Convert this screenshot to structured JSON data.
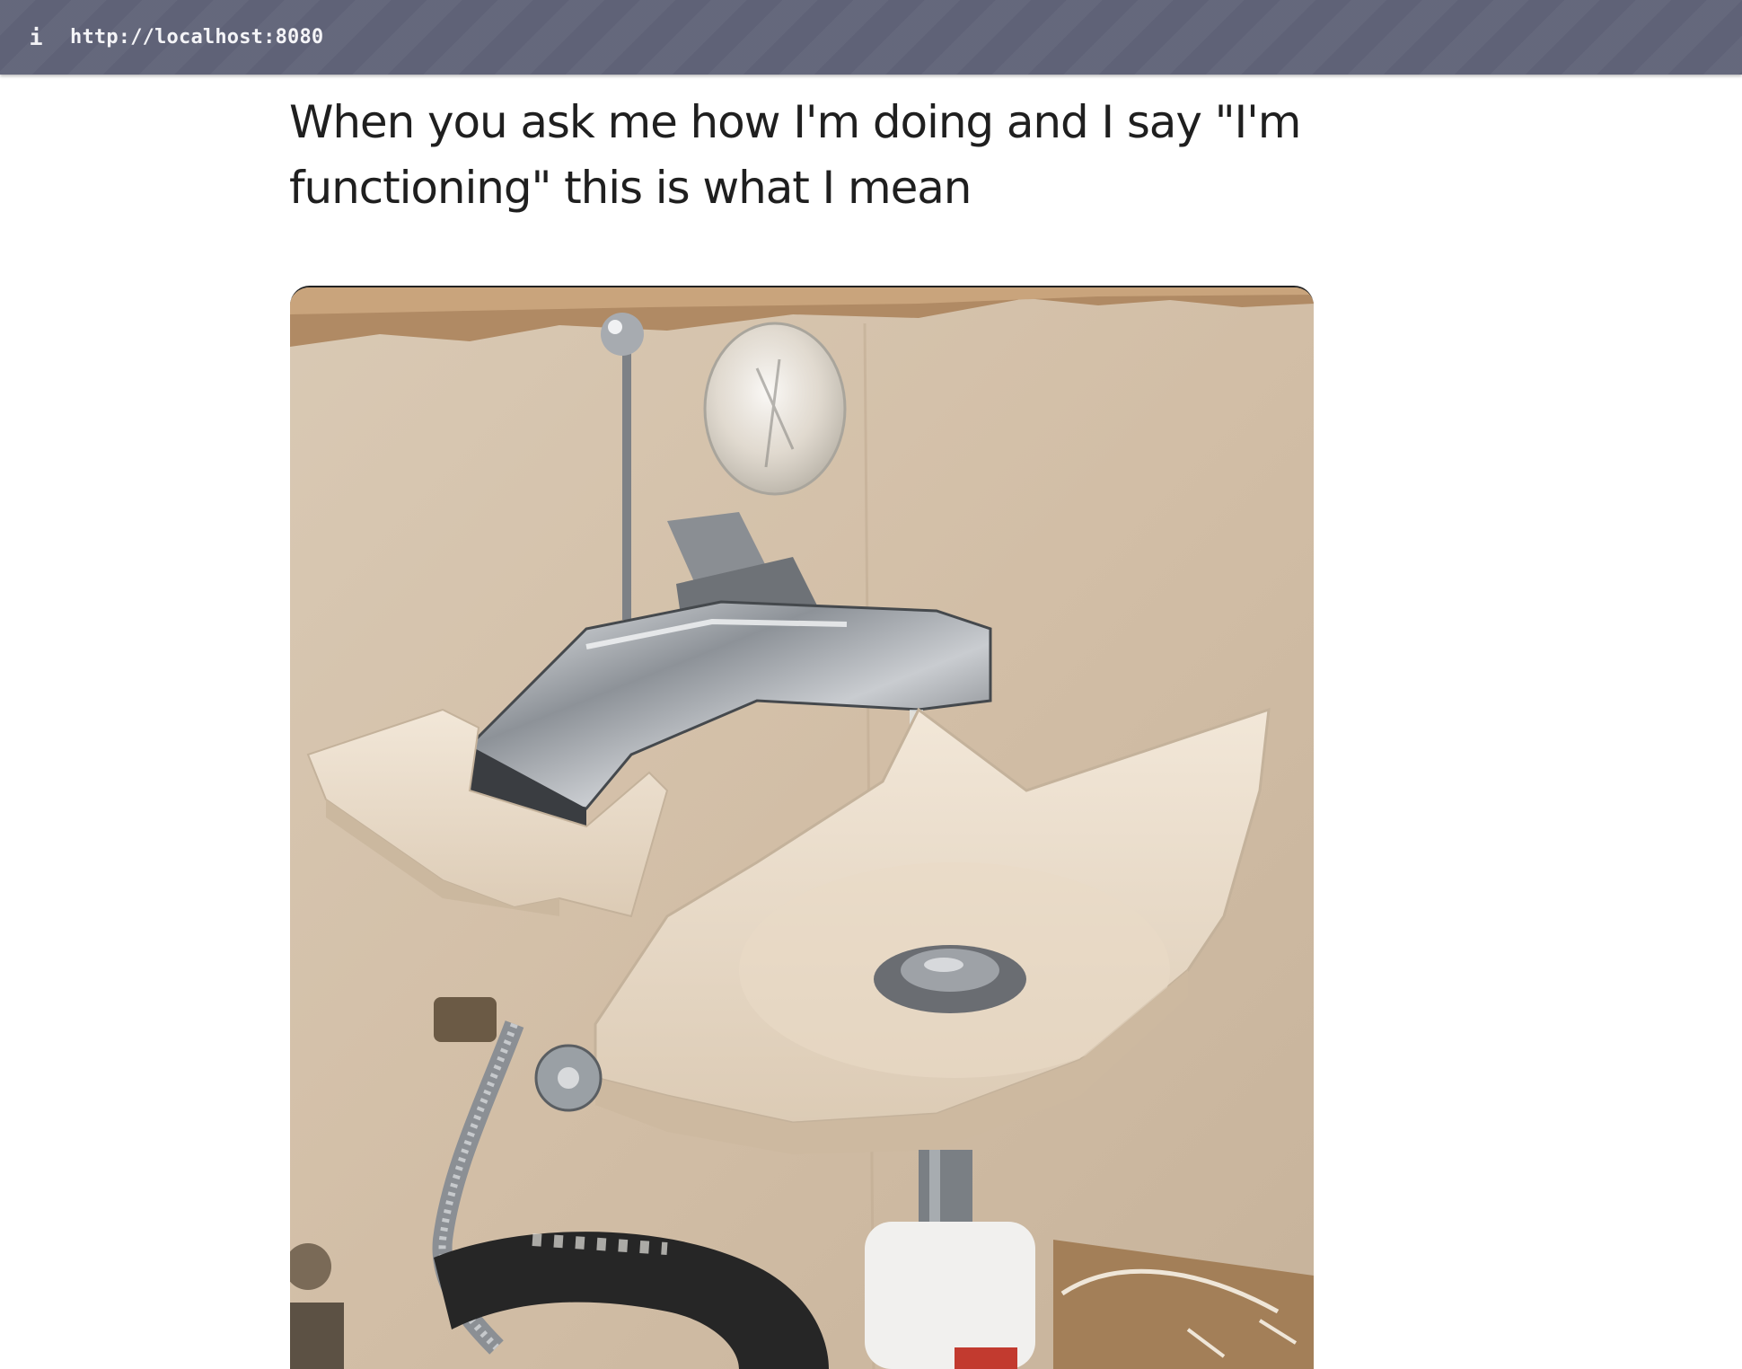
{
  "browser": {
    "info_icon": "info-icon",
    "info_glyph": "i",
    "url": "http://localhost:8080"
  },
  "post": {
    "caption": "When you ask me how I'm doing and I say \"I'm functioning\" this is what I mean",
    "image": {
      "subject": "broken-sink-photo"
    }
  },
  "colors": {
    "topbar": "#5f6277",
    "wall": "#d6c3ad",
    "sink": "#e9dccb",
    "chrome": "#9a9ea4"
  }
}
